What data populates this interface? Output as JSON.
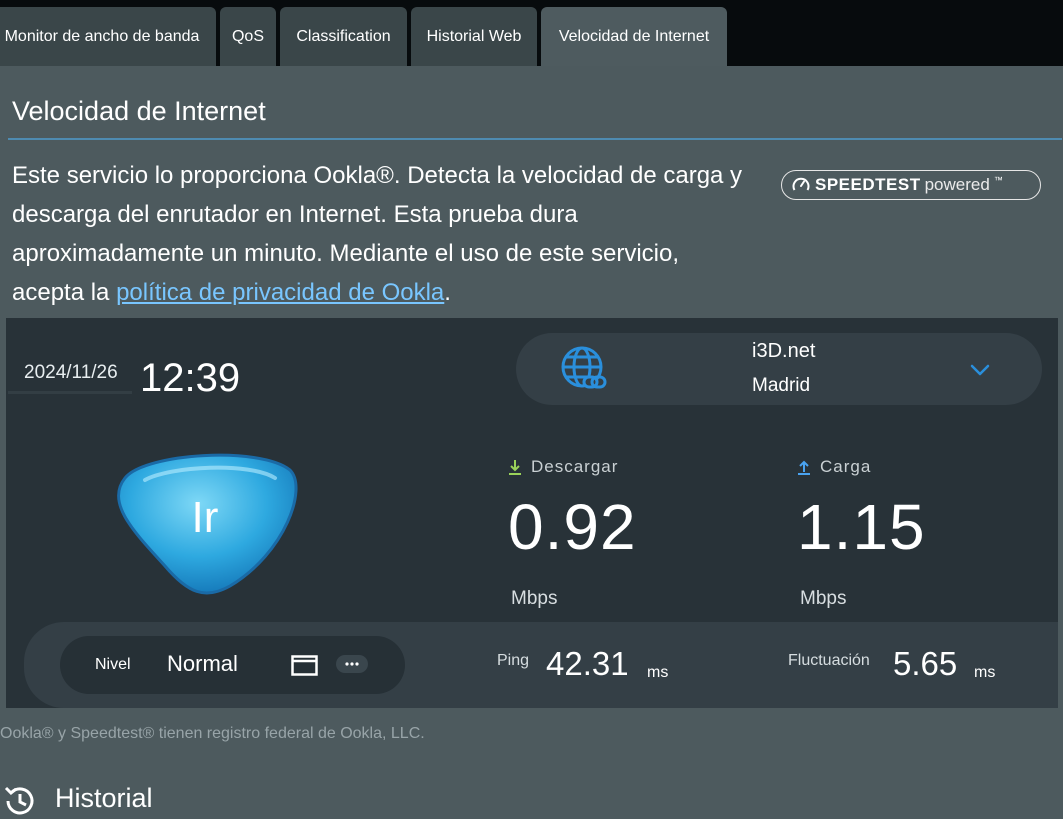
{
  "tabs": [
    {
      "label": "Monitor de ancho de banda"
    },
    {
      "label": "QoS"
    },
    {
      "label": "Classification"
    },
    {
      "label": "Historial Web"
    },
    {
      "label": "Velocidad de Internet"
    }
  ],
  "page": {
    "title": "Velocidad de Internet",
    "description": "Este servicio lo proporciona Ookla®. Detecta la velocidad de carga y descarga del enrutador en Internet. Esta prueba dura aproximadamente un minuto. Mediante el uso de este servicio, acepta la ",
    "privacy_link": "política de privacidad de Ookla",
    "description_end": ".",
    "badge_strong": "SPEEDTEST",
    "badge_light": "powered",
    "badge_tm": "™"
  },
  "test": {
    "date": "2024/11/26",
    "time": "12:39",
    "server_name": "i3D.net",
    "server_city": "Madrid",
    "go_label": "Ir",
    "download_label": "Descargar",
    "download_value": "0.92",
    "download_unit": "Mbps",
    "upload_label": "Carga",
    "upload_value": "1.15",
    "upload_unit": "Mbps",
    "nivel_label": "Nivel",
    "nivel_value": "Normal",
    "ping_label": "Ping",
    "ping_value": "42.31",
    "ping_unit": "ms",
    "jitter_label": "Fluctuación",
    "jitter_value": "5.65",
    "jitter_unit": "ms"
  },
  "legal": "Ookla® y Speedtest® tienen registro federal de Ookla, LLC.",
  "history": {
    "title": "Historial"
  },
  "colors": {
    "accent_blue": "#2a8fdc",
    "download_arrow": "#9bd35a",
    "upload_arrow": "#4aa3f0",
    "link": "#79c6ff"
  }
}
